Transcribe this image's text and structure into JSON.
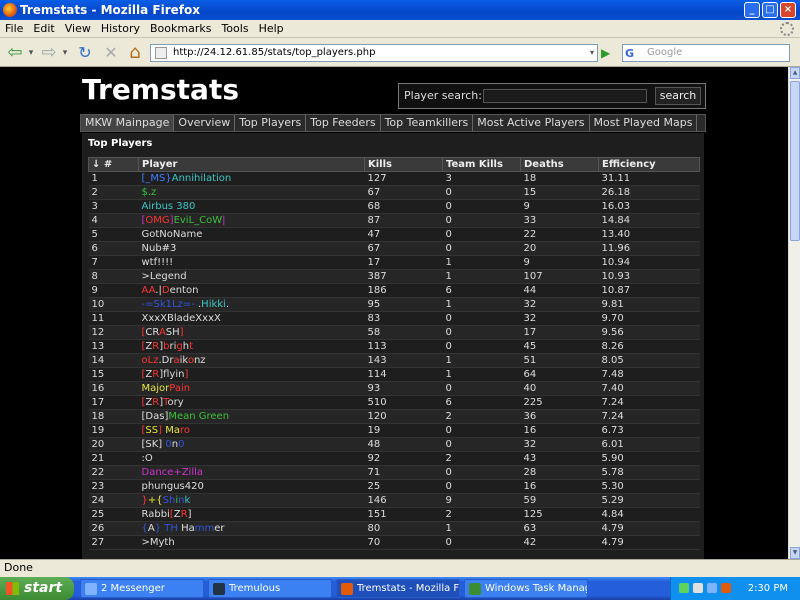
{
  "window": {
    "title": "Tremstats - Mozilla Firefox",
    "minimize": "_",
    "maximize": "□",
    "close": "×"
  },
  "menu": [
    "File",
    "Edit",
    "View",
    "History",
    "Bookmarks",
    "Tools",
    "Help"
  ],
  "nav": {
    "back": "⇦",
    "back_dd": "▾",
    "forward": "⇨",
    "forward_dd": "▾",
    "reload": "↻",
    "stop": "✕",
    "home": "⌂",
    "url": "http://24.12.61.85/stats/top_players.php",
    "url_dd": "▾",
    "go": "▶",
    "search_engine": "G",
    "search_placeholder": "Google"
  },
  "site": {
    "title": "Tremstats",
    "search_label": "Player search:",
    "search_button": "search"
  },
  "tabs": [
    "MKW Mainpage",
    "Overview",
    "Top Players",
    "Top Feeders",
    "Top Teamkillers",
    "Most Active Players",
    "Most Played Maps"
  ],
  "panel_title": "Top Players",
  "columns": [
    "↓ #",
    "Player",
    "Kills",
    "Team Kills",
    "Deaths",
    "Efficiency"
  ],
  "rows": [
    {
      "rank": "1",
      "segs": [
        {
          "t": "[_MS}",
          "c": "#3f7cff"
        },
        {
          "t": "Annihilation",
          "c": "#38c7c7"
        }
      ],
      "kills": "127",
      "tk": "3",
      "deaths": "18",
      "eff": "31.11"
    },
    {
      "rank": "2",
      "segs": [
        {
          "t": "$.z",
          "c": "#39c139"
        }
      ],
      "kills": "67",
      "tk": "0",
      "deaths": "15",
      "eff": "26.18"
    },
    {
      "rank": "3",
      "segs": [
        {
          "t": "Airbus 380",
          "c": "#38c7c7"
        }
      ],
      "kills": "68",
      "tk": "0",
      "deaths": "9",
      "eff": "16.03"
    },
    {
      "rank": "4",
      "segs": [
        {
          "t": "[",
          "c": "#cc33cc"
        },
        {
          "t": "OMG",
          "c": "#ff3333"
        },
        {
          "t": "]",
          "c": "#cc33cc"
        },
        {
          "t": "EviL_CoW",
          "c": "#39c139"
        },
        {
          "t": "|",
          "c": "#cc33cc"
        }
      ],
      "kills": "87",
      "tk": "0",
      "deaths": "33",
      "eff": "14.84"
    },
    {
      "rank": "5",
      "segs": [
        {
          "t": "GotNoName",
          "c": "#dddddd"
        }
      ],
      "kills": "47",
      "tk": "0",
      "deaths": "22",
      "eff": "13.40"
    },
    {
      "rank": "6",
      "segs": [
        {
          "t": "Nub#3",
          "c": "#dddddd"
        }
      ],
      "kills": "67",
      "tk": "0",
      "deaths": "20",
      "eff": "11.96"
    },
    {
      "rank": "7",
      "segs": [
        {
          "t": "wtf!!!!",
          "c": "#dddddd"
        }
      ],
      "kills": "17",
      "tk": "1",
      "deaths": "9",
      "eff": "10.94"
    },
    {
      "rank": "8",
      "segs": [
        {
          "t": ">Legend",
          "c": "#dddddd"
        }
      ],
      "kills": "387",
      "tk": "1",
      "deaths": "107",
      "eff": "10.93"
    },
    {
      "rank": "9",
      "segs": [
        {
          "t": "AA",
          "c": "#ff3333"
        },
        {
          "t": ".|",
          "c": "#dddddd"
        },
        {
          "t": "D",
          "c": "#ff3333"
        },
        {
          "t": "enton",
          "c": "#dddddd"
        }
      ],
      "kills": "186",
      "tk": "6",
      "deaths": "44",
      "eff": "10.87"
    },
    {
      "rank": "10",
      "segs": [
        {
          "t": "-=Sk1Lz=- ",
          "c": "#3355dd"
        },
        {
          "t": ".",
          "c": "#dddddd"
        },
        {
          "t": "Hikki",
          "c": "#38c7c7"
        },
        {
          "t": ".",
          "c": "#dddddd"
        }
      ],
      "kills": "95",
      "tk": "1",
      "deaths": "32",
      "eff": "9.81"
    },
    {
      "rank": "11",
      "segs": [
        {
          "t": "XxxXBladeXxxX",
          "c": "#dddddd"
        }
      ],
      "kills": "83",
      "tk": "0",
      "deaths": "32",
      "eff": "9.70"
    },
    {
      "rank": "12",
      "segs": [
        {
          "t": "[",
          "c": "#ff3333"
        },
        {
          "t": "CR",
          "c": "#dddddd"
        },
        {
          "t": "A",
          "c": "#ff3333"
        },
        {
          "t": "SH",
          "c": "#dddddd"
        },
        {
          "t": "]",
          "c": "#ff3333"
        }
      ],
      "kills": "58",
      "tk": "0",
      "deaths": "17",
      "eff": "9.56"
    },
    {
      "rank": "13",
      "segs": [
        {
          "t": "[",
          "c": "#ff3333"
        },
        {
          "t": "Z",
          "c": "#dddddd"
        },
        {
          "t": "R",
          "c": "#ff3333"
        },
        {
          "t": "]",
          "c": "#dddddd"
        },
        {
          "t": "b",
          "c": "#ff3333"
        },
        {
          "t": "ri",
          "c": "#dddddd"
        },
        {
          "t": "g",
          "c": "#ff3333"
        },
        {
          "t": "h",
          "c": "#dddddd"
        },
        {
          "t": "t",
          "c": "#ff3333"
        }
      ],
      "kills": "113",
      "tk": "0",
      "deaths": "45",
      "eff": "8.26"
    },
    {
      "rank": "14",
      "segs": [
        {
          "t": "oLz",
          "c": "#ff3333"
        },
        {
          "t": ".Dr",
          "c": "#dddddd"
        },
        {
          "t": "a",
          "c": "#ff3333"
        },
        {
          "t": "ik",
          "c": "#dddddd"
        },
        {
          "t": "o",
          "c": "#ff3333"
        },
        {
          "t": "nz",
          "c": "#dddddd"
        }
      ],
      "kills": "143",
      "tk": "1",
      "deaths": "51",
      "eff": "8.05"
    },
    {
      "rank": "15",
      "segs": [
        {
          "t": "[",
          "c": "#ff3333"
        },
        {
          "t": "Z",
          "c": "#dddddd"
        },
        {
          "t": "R",
          "c": "#ff3333"
        },
        {
          "t": "]flyin",
          "c": "#dddddd"
        },
        {
          "t": "]",
          "c": "#ff3333"
        }
      ],
      "kills": "114",
      "tk": "1",
      "deaths": "64",
      "eff": "7.48"
    },
    {
      "rank": "16",
      "segs": [
        {
          "t": "Major",
          "c": "#e6e63a"
        },
        {
          "t": "Pain",
          "c": "#ff3333"
        }
      ],
      "kills": "93",
      "tk": "0",
      "deaths": "40",
      "eff": "7.40"
    },
    {
      "rank": "17",
      "segs": [
        {
          "t": "[",
          "c": "#ff3333"
        },
        {
          "t": "Z",
          "c": "#dddddd"
        },
        {
          "t": "R",
          "c": "#ff3333"
        },
        {
          "t": "]",
          "c": "#dddddd"
        },
        {
          "t": "T",
          "c": "#ff3333"
        },
        {
          "t": "ory",
          "c": "#dddddd"
        }
      ],
      "kills": "510",
      "tk": "6",
      "deaths": "225",
      "eff": "7.24"
    },
    {
      "rank": "18",
      "segs": [
        {
          "t": "[Das]",
          "c": "#dddddd"
        },
        {
          "t": "Mean Green",
          "c": "#39c139"
        }
      ],
      "kills": "120",
      "tk": "2",
      "deaths": "36",
      "eff": "7.24"
    },
    {
      "rank": "19",
      "segs": [
        {
          "t": "[",
          "c": "#ff3333"
        },
        {
          "t": "SS",
          "c": "#e6e63a"
        },
        {
          "t": "] ",
          "c": "#ff3333"
        },
        {
          "t": "Ma",
          "c": "#e6e63a"
        },
        {
          "t": "ro",
          "c": "#ff3333"
        }
      ],
      "kills": "19",
      "tk": "0",
      "deaths": "16",
      "eff": "6.73"
    },
    {
      "rank": "20",
      "segs": [
        {
          "t": "[SK]",
          "c": "#dddddd"
        },
        {
          "t": " 0",
          "c": "#3355dd"
        },
        {
          "t": "n",
          "c": "#dddddd"
        },
        {
          "t": "0",
          "c": "#3355dd"
        }
      ],
      "kills": "48",
      "tk": "0",
      "deaths": "32",
      "eff": "6.01"
    },
    {
      "rank": "21",
      "segs": [
        {
          "t": ":O",
          "c": "#dddddd"
        }
      ],
      "kills": "92",
      "tk": "2",
      "deaths": "43",
      "eff": "5.90"
    },
    {
      "rank": "22",
      "segs": [
        {
          "t": "Dance+Zilla",
          "c": "#cc33cc"
        }
      ],
      "kills": "71",
      "tk": "0",
      "deaths": "28",
      "eff": "5.78"
    },
    {
      "rank": "23",
      "segs": [
        {
          "t": "phungus420",
          "c": "#dddddd"
        }
      ],
      "kills": "25",
      "tk": "0",
      "deaths": "16",
      "eff": "5.30"
    },
    {
      "rank": "24",
      "segs": [
        {
          "t": "}",
          "c": "#ff3333"
        },
        {
          "t": "+{",
          "c": "#e6e63a"
        },
        {
          "t": "Sh",
          "c": "#3355dd"
        },
        {
          "t": "i",
          "c": "#39c139"
        },
        {
          "t": "n",
          "c": "#3355dd"
        },
        {
          "t": "k",
          "c": "#38c7c7"
        }
      ],
      "kills": "146",
      "tk": "9",
      "deaths": "59",
      "eff": "5.29"
    },
    {
      "rank": "25",
      "segs": [
        {
          "t": "Rabbi",
          "c": "#dddddd"
        },
        {
          "t": "[",
          "c": "#ff3333"
        },
        {
          "t": "Z",
          "c": "#dddddd"
        },
        {
          "t": "R",
          "c": "#ff3333"
        },
        {
          "t": "]",
          "c": "#dddddd"
        }
      ],
      "kills": "151",
      "tk": "2",
      "deaths": "125",
      "eff": "4.84"
    },
    {
      "rank": "26",
      "segs": [
        {
          "t": "{",
          "c": "#3355dd"
        },
        {
          "t": "A",
          "c": "#dddddd"
        },
        {
          "t": "}",
          "c": "#3355dd"
        },
        {
          "t": " TH ",
          "c": "#3355dd"
        },
        {
          "t": "Ha",
          "c": "#dddddd"
        },
        {
          "t": "mm",
          "c": "#3355dd"
        },
        {
          "t": "er",
          "c": "#dddddd"
        }
      ],
      "kills": "80",
      "tk": "1",
      "deaths": "63",
      "eff": "4.79"
    },
    {
      "rank": "27",
      "segs": [
        {
          "t": ">Myth",
          "c": "#dddddd"
        }
      ],
      "kills": "70",
      "tk": "0",
      "deaths": "42",
      "eff": "4.79"
    }
  ],
  "status": "Done",
  "taskbar": {
    "start": "start",
    "items": [
      {
        "label": "2 Messenger",
        "icon": "#7fb2ff"
      },
      {
        "label": "Tremulous",
        "icon": "#223344"
      },
      {
        "label": "Tremstats - Mozilla Fir...",
        "icon": "#e25a0b"
      },
      {
        "label": "Windows Task Manager",
        "icon": "#3c8c33"
      }
    ],
    "clock": "2:30 PM"
  }
}
